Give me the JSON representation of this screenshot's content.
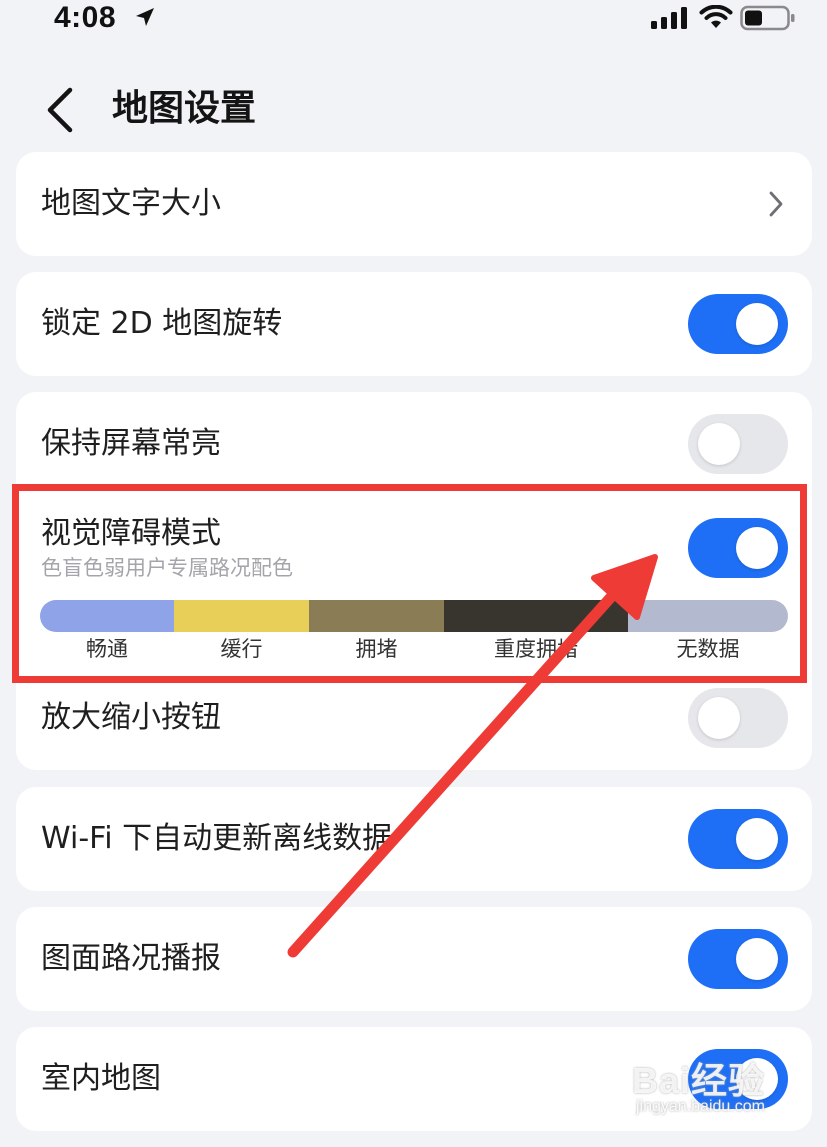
{
  "status_bar": {
    "time": "4:08"
  },
  "header": {
    "title": "地图设置"
  },
  "settings": {
    "map_text_size": {
      "label": "地图文字大小"
    },
    "lock_2d_rotation": {
      "label": "锁定 2D 地图旋转",
      "enabled": true
    },
    "keep_screen_on": {
      "label": "保持屏幕常亮",
      "enabled": false
    },
    "visual_impairment_mode": {
      "label": "视觉障碍模式",
      "subtitle": "色盲色弱用户专属路况配色",
      "enabled": true,
      "legend": [
        {
          "label": "畅通",
          "color": "#8FA4E8"
        },
        {
          "label": "缓行",
          "color": "#E8CF58"
        },
        {
          "label": "拥堵",
          "color": "#8A7D55"
        },
        {
          "label": "重度拥堵",
          "color": "#38352F"
        },
        {
          "label": "无数据",
          "color": "#B3BAD0"
        }
      ]
    },
    "zoom_buttons": {
      "label": "放大缩小按钮",
      "enabled": false
    },
    "wifi_auto_update": {
      "label": "Wi-Fi 下自动更新离线数据",
      "enabled": true
    },
    "traffic_broadcast": {
      "label": "图面路况播报",
      "enabled": true
    },
    "indoor_map": {
      "label": "室内地图",
      "enabled": true
    }
  },
  "colors": {
    "toggle_on": "#1E6FF5",
    "toggle_off": "#E6E7EB",
    "annotation": "#EF3B36",
    "background": "#F2F3F6"
  },
  "watermark": {
    "text": "Bai经验",
    "sub": "jingyan.baidu.com"
  }
}
